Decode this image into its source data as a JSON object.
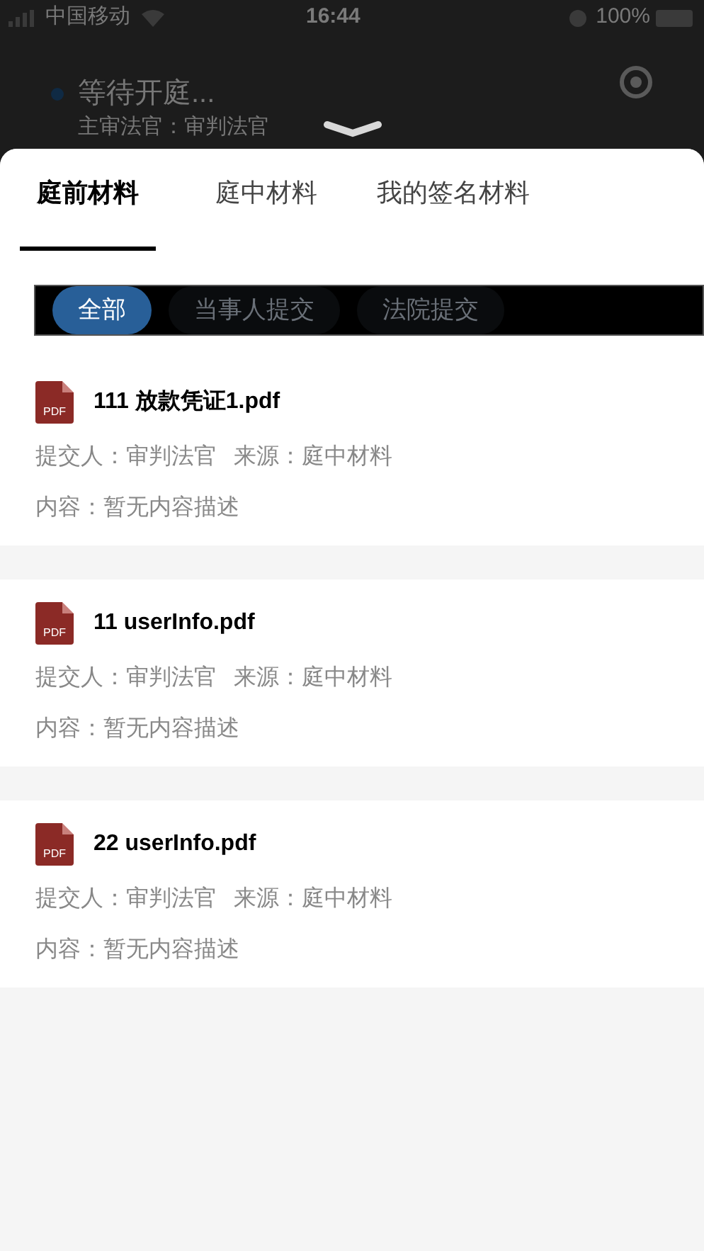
{
  "status_bar": {
    "carrier": "中国移动",
    "time": "16:44",
    "battery": "100%"
  },
  "background": {
    "status": "等待开庭...",
    "judge": "主审法官：审判法官"
  },
  "tabs": [
    {
      "label": "庭前材料",
      "selected": true
    },
    {
      "label": "庭中材料",
      "selected": false
    },
    {
      "label": "我的签名材料",
      "selected": false
    }
  ],
  "filters": [
    {
      "label": "全部",
      "selected": true
    },
    {
      "label": "当事人提交",
      "selected": false
    },
    {
      "label": "法院提交",
      "selected": false
    }
  ],
  "files": [
    {
      "file_type": "PDF",
      "name": "111 放款凭证1.pdf",
      "submitter": "提交人：审判法官",
      "source": "来源：庭中材料",
      "content": "内容：暂无内容描述"
    },
    {
      "file_type": "PDF",
      "name": "11 userInfo.pdf",
      "submitter": "提交人：审判法官",
      "source": "来源：庭中材料",
      "content": "内容：暂无内容描述"
    },
    {
      "file_type": "PDF",
      "name": "22 userInfo.pdf",
      "submitter": "提交人：审判法官",
      "source": "来源：庭中材料",
      "content": "内容：暂无内容描述"
    }
  ]
}
